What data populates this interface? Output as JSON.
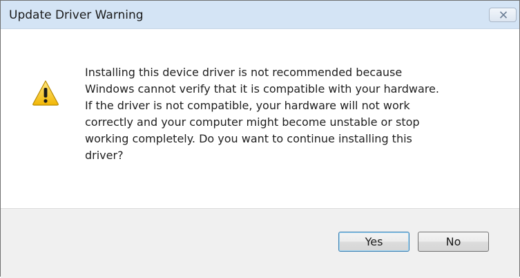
{
  "dialog": {
    "title": "Update Driver Warning",
    "close_icon": "close-icon",
    "warning_icon": "warning-icon",
    "message": "Installing this device driver is not recommended because\nWindows cannot verify that it is compatible with your hardware.\nIf the driver is not compatible, your hardware will not work\ncorrectly and your computer might become unstable or stop\nworking completely.  Do you want to continue installing this\ndriver?",
    "buttons": {
      "yes_label": "Yes",
      "no_label": "No"
    }
  },
  "colors": {
    "titlebar": "#d4e4f5",
    "body": "#ffffff",
    "footer": "#f0f0f0",
    "default_button_border": "#3c7fb1",
    "warning_yellow": "#f5c518"
  }
}
